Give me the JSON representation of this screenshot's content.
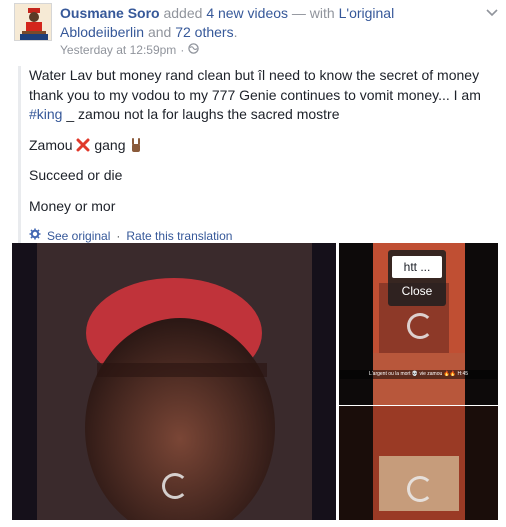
{
  "post": {
    "author": "Ousmane Soro",
    "action_text": "added",
    "videos_link": "4 new videos",
    "with_text": "— with",
    "tagged_1": "L'original Ablodeiiberlin",
    "and_text": "and",
    "others_link": "72 others",
    "timestamp": "Yesterday at 12:59pm",
    "separator": "·"
  },
  "content": {
    "paragraph_1a": "Water Lav but money rand clean but îl need to know the secret of money thank you to my vodou to my 777 Genie continues to vomit money... I am",
    "hashtag": "#king",
    "paragraph_1b": "_ zamou not la for laughs the sacred mostre",
    "line_2_start": "Zamou",
    "line_2_end": "gang",
    "line_3": "Succeed or die",
    "line_4": "Money or mor"
  },
  "translation": {
    "see_original": "See original",
    "separator": "·",
    "rate": "Rate this translation"
  },
  "media": {
    "tooltip_url": "htt ...",
    "tooltip_close": "Close",
    "caption": "L'argent ou la mort 💀 vie zamou 🔥🔥 H:45"
  },
  "colors": {
    "link": "#365899",
    "muted": "#90949c",
    "text": "#1d2129",
    "cross": "#e0392b"
  }
}
